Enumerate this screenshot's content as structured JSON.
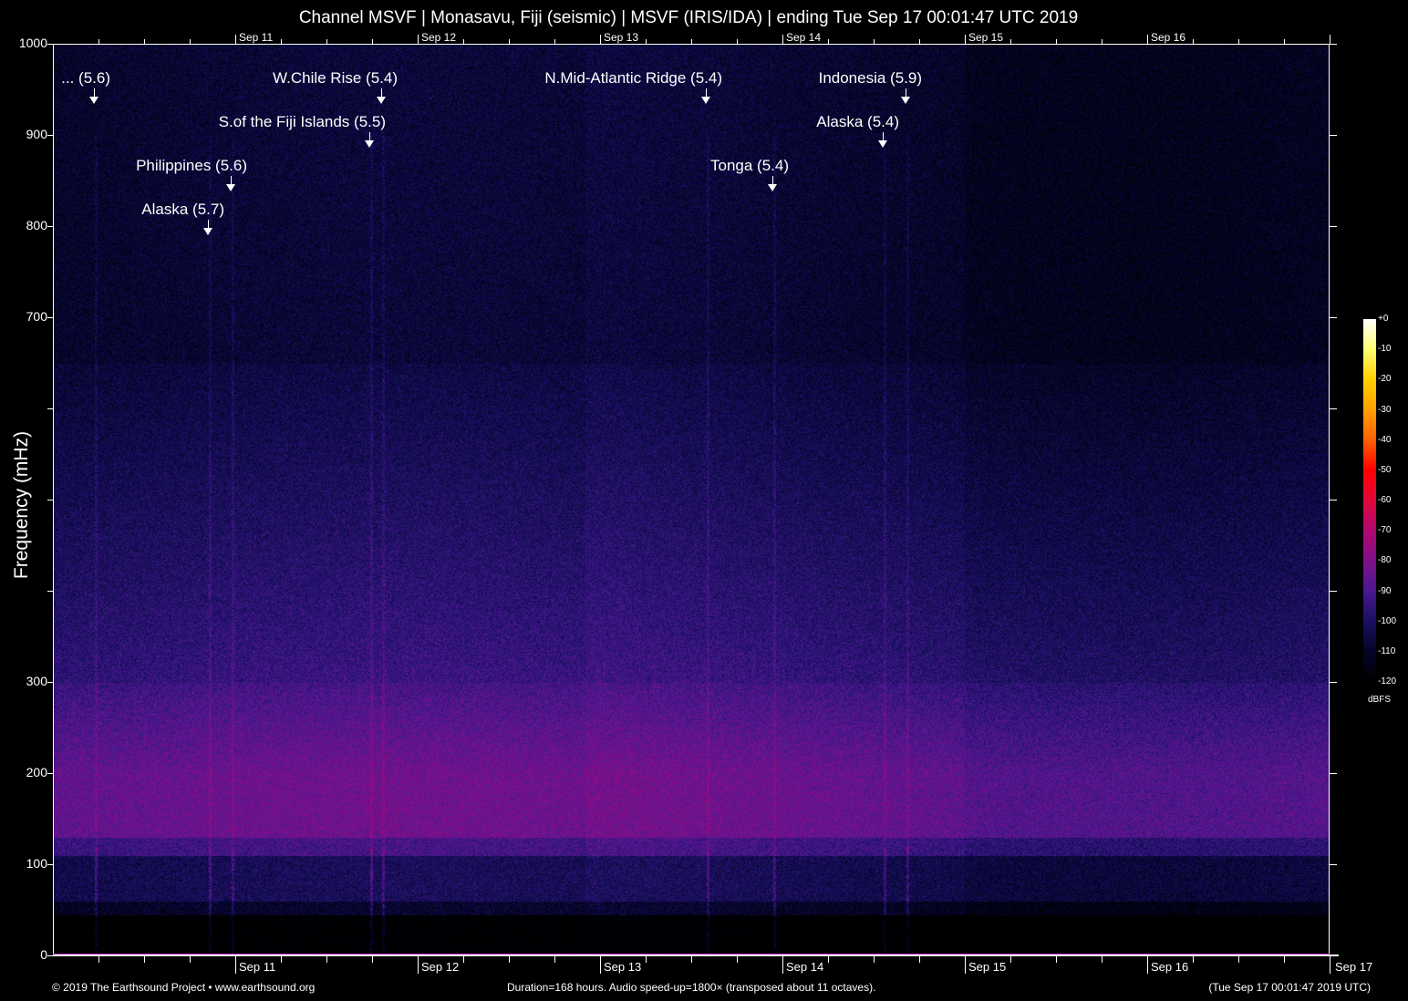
{
  "chart_data": {
    "type": "heatmap",
    "title": "Channel MSVF | Monasavu, Fiji (seismic) | MSVF (IRIS/IDA) | ending Tue Sep 17 00:01:47 UTC 2019",
    "ylabel": "Frequency (mHz)",
    "ylim": [
      0,
      1000
    ],
    "y_ticks": [
      0,
      100,
      200,
      300,
      400,
      500,
      600,
      700,
      800,
      900,
      1000
    ],
    "y_tick_labels": [
      "0",
      "100",
      "200",
      "300",
      "",
      "",
      "",
      "700",
      "800",
      "900",
      "1000"
    ],
    "x_range_hours": [
      0,
      168
    ],
    "x_tick_interval_hours": 6,
    "day_labels": [
      "Sep 11",
      "Sep 12",
      "Sep 13",
      "Sep 14",
      "Sep 15",
      "Sep 16"
    ],
    "end_label": "Sep 17",
    "colorbar": {
      "unit": "dBFS",
      "range": [
        -120,
        0
      ],
      "ticks": [
        "+0",
        "-10",
        "-20",
        "-30",
        "-40",
        "-50",
        "-60",
        "-70",
        "-80",
        "-90",
        "-100",
        "-110",
        "-120"
      ],
      "colors": [
        "#ffffff",
        "#ffff70",
        "#ffd000",
        "#ffa000",
        "#ff6000",
        "#ff0000",
        "#e0083c",
        "#b00870",
        "#80108a",
        "#4a1890",
        "#181060",
        "#040428",
        "#000000"
      ]
    },
    "band_levels_dbfs": [
      {
        "freq_mhz": [
          0,
          45
        ],
        "level": -120
      },
      {
        "freq_mhz": [
          45,
          110
        ],
        "level": -104
      },
      {
        "freq_mhz": [
          110,
          300
        ],
        "level": -86
      },
      {
        "freq_mhz": [
          300,
          600
        ],
        "level": -100
      },
      {
        "freq_mhz": [
          600,
          1000
        ],
        "level": -110
      }
    ],
    "events": [
      {
        "label": "... (5.6)",
        "hour": 5.4
      },
      {
        "label": "W.Chile Rise (5.4)",
        "hour": 43.2
      },
      {
        "label": "S.of the Fiji Islands (5.5)",
        "hour": 41.6
      },
      {
        "label": "Philippines (5.6)",
        "hour": 23.4
      },
      {
        "label": "Alaska (5.7)",
        "hour": 20.4
      },
      {
        "label": "N.Mid-Atlantic Ridge (5.4)",
        "hour": 85.9
      },
      {
        "label": "Indonesia (5.9)",
        "hour": 112.2
      },
      {
        "label": "Alaska (5.4)",
        "hour": 109.2
      },
      {
        "label": "Tonga (5.4)",
        "hour": 94.7
      }
    ]
  },
  "footer": {
    "copyright": "© 2019 The Earthsound Project • www.earthsound.org",
    "info": "Duration=168 hours. Audio speed-up=1800× (transposed about 11 octaves).",
    "timestamp": "(Tue Sep 17 00:01:47 2019 UTC)"
  }
}
